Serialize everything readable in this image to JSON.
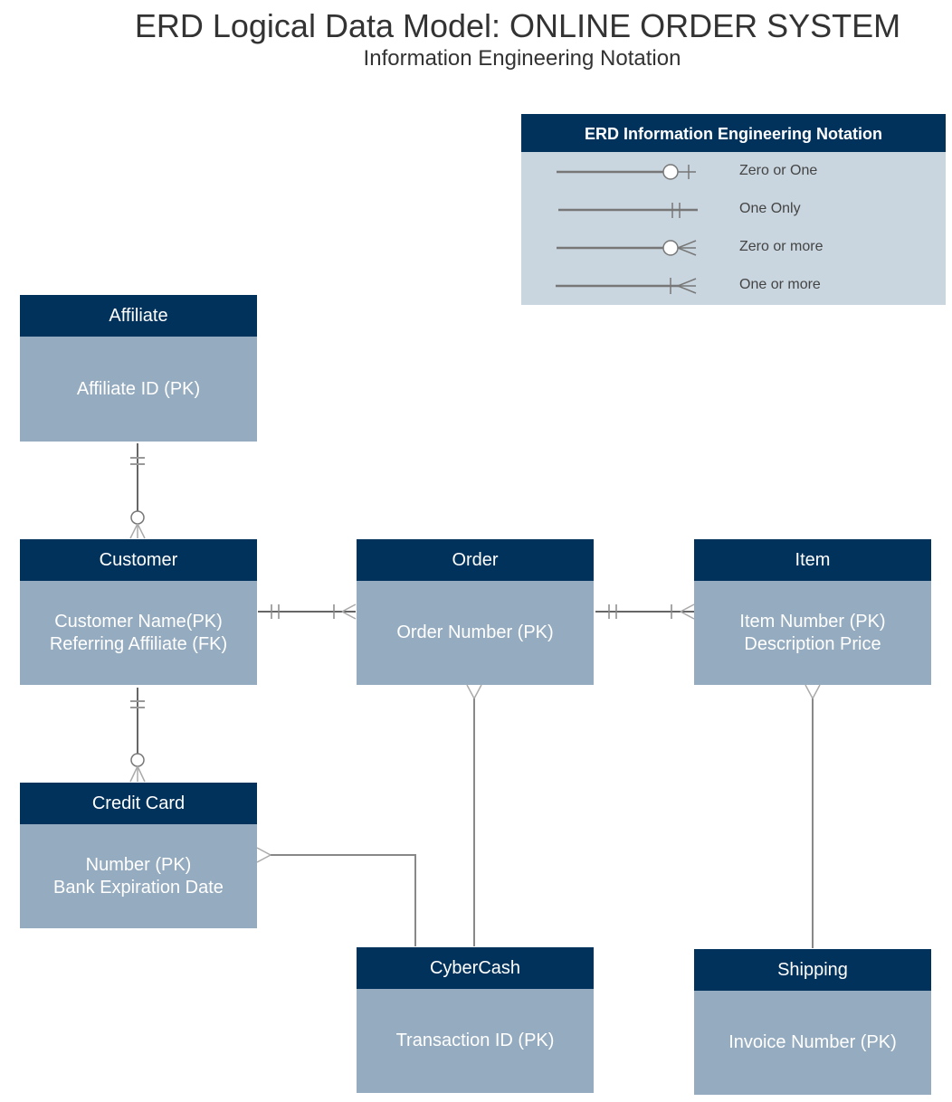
{
  "title": "ERD Logical Data Model: ONLINE ORDER SYSTEM",
  "subtitle": "Information Engineering Notation",
  "legend": {
    "title": "ERD Information Engineering Notation",
    "items": [
      {
        "symbol": "zero-or-one",
        "label": "Zero or One"
      },
      {
        "symbol": "one-only",
        "label": "One Only"
      },
      {
        "symbol": "zero-or-more",
        "label": "Zero or more"
      },
      {
        "symbol": "one-or-more",
        "label": "One or more"
      }
    ]
  },
  "entities": {
    "affiliate": {
      "name": "Affiliate",
      "attributes": [
        "Affiliate ID (PK)"
      ]
    },
    "customer": {
      "name": "Customer",
      "attributes": [
        "Customer Name(PK)",
        "Referring Affiliate (FK)"
      ]
    },
    "order": {
      "name": "Order",
      "attributes": [
        "Order Number (PK)"
      ]
    },
    "item": {
      "name": "Item",
      "attributes": [
        "Item Number (PK)",
        "Description Price"
      ]
    },
    "credit_card": {
      "name": "Credit Card",
      "attributes": [
        "Number (PK)",
        "Bank Expiration Date"
      ]
    },
    "cybercash": {
      "name": "CyberCash",
      "attributes": [
        "Transaction ID (PK)"
      ]
    },
    "shipping": {
      "name": "Shipping",
      "attributes": [
        "Invoice Number (PK)"
      ]
    }
  },
  "relationships": [
    {
      "from": "Affiliate",
      "from_cardinality": "one-only",
      "to": "Customer",
      "to_cardinality": "zero-or-more"
    },
    {
      "from": "Customer",
      "from_cardinality": "one-only",
      "to": "Order",
      "to_cardinality": "one-or-more"
    },
    {
      "from": "Order",
      "from_cardinality": "one-only",
      "to": "Item",
      "to_cardinality": "one-or-more"
    },
    {
      "from": "Customer",
      "from_cardinality": "one-only",
      "to": "Credit Card",
      "to_cardinality": "zero-or-more"
    },
    {
      "from": "CyberCash",
      "from_cardinality": "none",
      "to": "Credit Card",
      "to_cardinality": "many"
    },
    {
      "from": "CyberCash",
      "from_cardinality": "none",
      "to": "Order",
      "to_cardinality": "many"
    },
    {
      "from": "Shipping",
      "from_cardinality": "none",
      "to": "Item",
      "to_cardinality": "many"
    }
  ]
}
